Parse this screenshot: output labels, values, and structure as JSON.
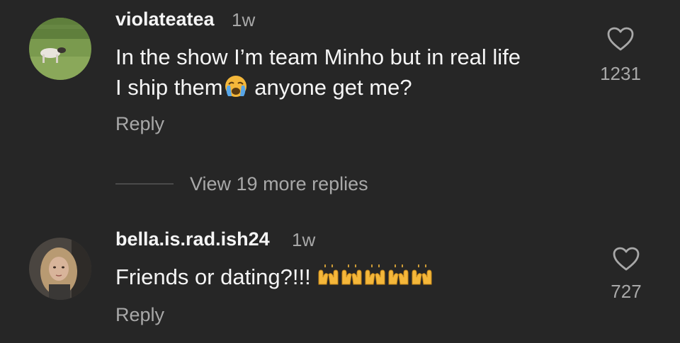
{
  "comments": [
    {
      "username": "violateatea",
      "time": "1w",
      "text_line1": "In the show I’m team Minho but in real life",
      "text_line2_before": "I ship them",
      "text_line2_emoji": "crying-face-emoji",
      "text_line2_after": " anyone get me?",
      "reply_label": "Reply",
      "likes": "1231"
    },
    {
      "username": "bella.is.rad.ish24",
      "time": "1w",
      "text": "Friends or dating?!!! ",
      "emoji": "raising-hands-emoji",
      "reply_label": "Reply",
      "likes": "727"
    }
  ],
  "view_more_replies": "View 19 more replies",
  "colors": {
    "background": "#262626",
    "primary_text": "#f5f5f5",
    "secondary_text": "#a8a8a8",
    "emoji_yellow": "#f4b73a"
  }
}
